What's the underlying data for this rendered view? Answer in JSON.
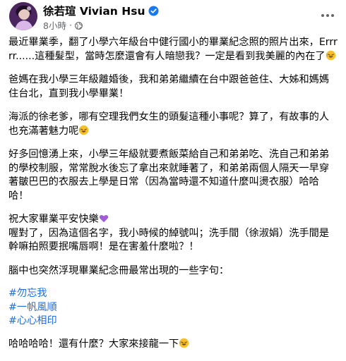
{
  "post": {
    "author": "徐若瑄 Vivian Hsu",
    "time": "8小時",
    "dot": "·",
    "paragraphs": {
      "p1_a": "最近畢業季，翻了小學六年級台中健行國小的畢業紀念照的照片出來，Errrrr......這種髮型，當時怎麼還會有人暗戀我？一定是看到我美麗的內在了",
      "p2": "爸媽在我小學三年級離婚後，我和弟弟繼續在台中跟爸爸住、大姊和媽媽住台北，直到我小學畢業！",
      "p3_a": "海派的徐老爹，哪有空理我們女生的頭髮這種小事呢？算了，有故事的人也充滿著魅力呢",
      "p4": "好多回憶湧上來，小學三年級就要煮飯菜給自己和弟弟吃、洗自己和弟弟的學校制服，常常脫水後忘了拿出來就睡著了，和弟弟兩個人隔天一早穿著皺巴巴的衣服去上學是日常（因為當時還不知道什麼叫燙衣服）哈哈哈！",
      "p5_a": "祝大家畢業平安快樂",
      "p5_b": "喔對了，因為這個名字，我小時候的綽號叫；洗手間（徐淑娟）洗手間是幹嘛拍照要抿嘴唇啊！是在害羞什麼啦？！",
      "p6": "腦中也突然浮現畢業紀念冊最常出現的一些字句：",
      "p8_a": "哈哈哈哈！還有什麼？大家來接龍一下"
    },
    "hashtags": [
      "#勿忘我",
      "#一帆風順",
      "#心心相印"
    ]
  },
  "icons": {
    "avatar": "profile-photo",
    "verified": "verified-badge-icon",
    "globe": "globe-icon",
    "more": "more-options-icon",
    "emoji_laugh": "rolling-laughing-emoji",
    "emoji_heart": "purple-heart-emoji"
  },
  "colors": {
    "text": "#050505",
    "secondary": "#65676b",
    "link": "#216fdb",
    "verified": "#1877f2"
  }
}
